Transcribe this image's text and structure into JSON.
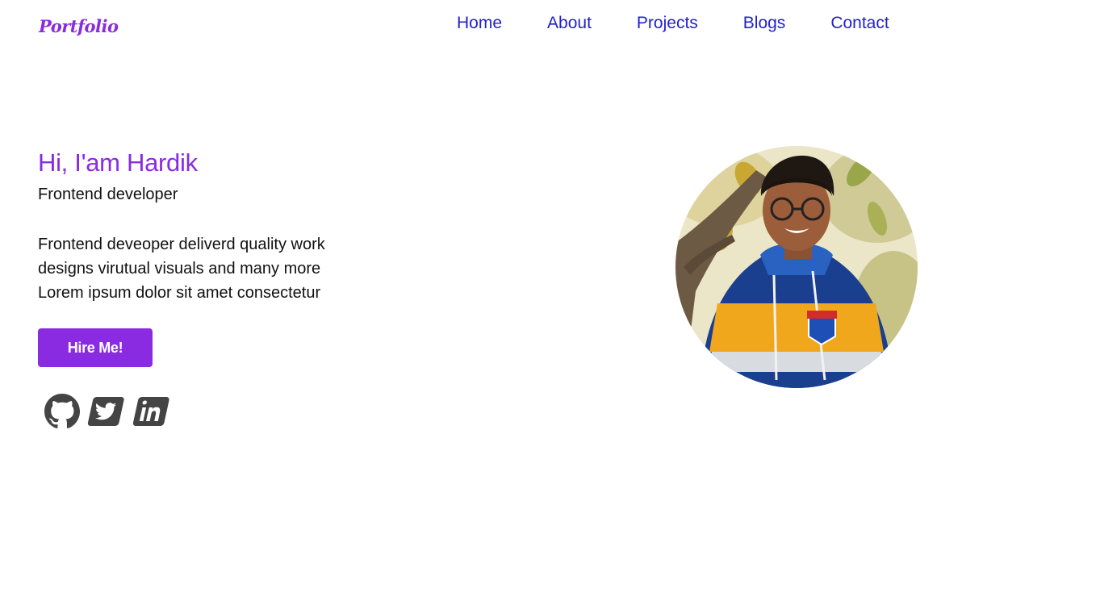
{
  "header": {
    "logo": "Portfolio",
    "nav": [
      "Home",
      "About",
      "Projects",
      "Blogs",
      "Contact"
    ]
  },
  "hero": {
    "greeting": "Hi, I'am Hardik",
    "role": "Frontend developer",
    "description": [
      "Frontend deveoper deliverd quality work",
      "designs virutual visuals and many more",
      "Lorem ipsum dolor sit amet consectetur"
    ],
    "cta_label": "Hire Me!"
  },
  "socials": [
    {
      "icon": "github-icon"
    },
    {
      "icon": "twitter-icon"
    },
    {
      "icon": "linkedin-icon"
    }
  ],
  "colors": {
    "accent": "#8a2be2",
    "nav_link": "#2222cc",
    "icon": "#444444"
  }
}
